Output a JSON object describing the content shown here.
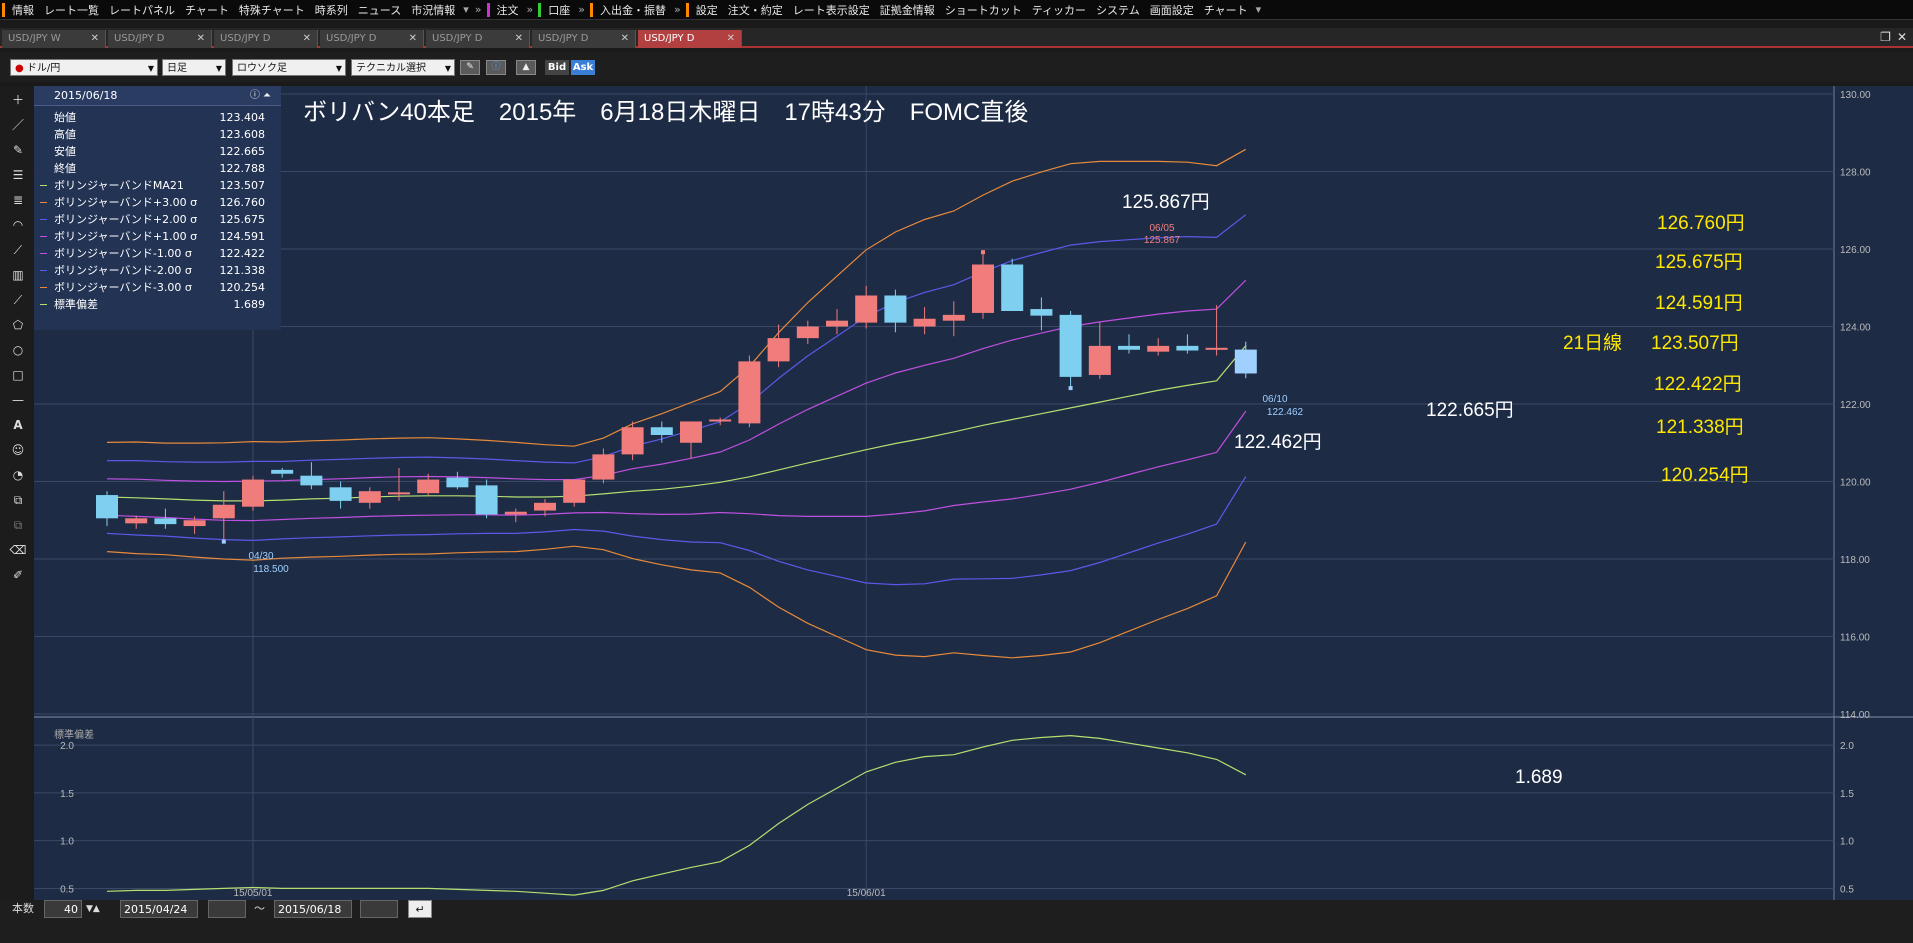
{
  "menu": {
    "items": [
      "情報",
      "レート一覧",
      "レートパネル",
      "チャート",
      "特殊チャート",
      "時系列",
      "ニュース",
      "市況情報",
      "注文",
      "口座",
      "入出金・振替",
      "設定",
      "注文・約定",
      "レート表示設定",
      "証拠金情報",
      "ショートカット",
      "ティッカー",
      "システム",
      "画面設定",
      "チャート"
    ]
  },
  "tabs": [
    {
      "label": "USD/JPY W"
    },
    {
      "label": "USD/JPY D"
    },
    {
      "label": "USD/JPY D"
    },
    {
      "label": "USD/JPY D"
    },
    {
      "label": "USD/JPY D"
    },
    {
      "label": "USD/JPY D"
    },
    {
      "label": "USD/JPY D"
    }
  ],
  "toolbar": {
    "symbol": "ドル/円",
    "period": "日足",
    "charttype": "ロウソク足",
    "technical": "テクニカル選択",
    "bid": "Bid",
    "ask": "Ask"
  },
  "info": {
    "date": "2015/06/18",
    "rows": [
      {
        "label": "始値",
        "value": "123.404",
        "color": ""
      },
      {
        "label": "高値",
        "value": "123.608",
        "color": ""
      },
      {
        "label": "安値",
        "value": "122.665",
        "color": ""
      },
      {
        "label": "終値",
        "value": "122.788",
        "color": ""
      },
      {
        "label": "ボリンジャーバンドMA21",
        "value": "123.507",
        "color": "#b4e070"
      },
      {
        "label": "ボリンジャーバンド+3.00 σ",
        "value": "126.760",
        "color": "#e88a3a"
      },
      {
        "label": "ボリンジャーバンド+2.00 σ",
        "value": "125.675",
        "color": "#5a5ae8"
      },
      {
        "label": "ボリンジャーバンド+1.00 σ",
        "value": "124.591",
        "color": "#c050e0"
      },
      {
        "label": "ボリンジャーバンド-1.00 σ",
        "value": "122.422",
        "color": "#c050e0"
      },
      {
        "label": "ボリンジャーバンド-2.00 σ",
        "value": "121.338",
        "color": "#5a5ae8"
      },
      {
        "label": "ボリンジャーバンド-3.00 σ",
        "value": "120.254",
        "color": "#e88a3a"
      },
      {
        "label": "標準偏差",
        "value": "1.689",
        "color": "#b4e070"
      }
    ]
  },
  "annotations": {
    "title": "ボリバン40本足　2015年　6月18日木曜日　17時43分　FOMC直後",
    "high_label": "125.867円",
    "high_mark_date": "06/05",
    "high_mark_value": "125.867",
    "low_mark_date": "06/10",
    "low_mark_value": "122.462",
    "low_label": "122.462円",
    "close_low_label": "122.665円",
    "early_low_date": "04/30",
    "early_low_value": "118.500",
    "b3u": "126.760円",
    "b2u": "125.675円",
    "b1u": "124.591円",
    "ma_prefix": "21日線",
    "ma": "123.507円",
    "b1l": "122.422円",
    "b2l": "121.338円",
    "b3l": "120.254円",
    "sd_value": "1.689",
    "sd_panel_label": "標準偏差",
    "date_tick_1": "15/05/01",
    "date_tick_2": "15/06/01"
  },
  "bottom": {
    "label": "本数",
    "count": "40",
    "from": "2015/04/24",
    "tilde": "～",
    "to": "2015/06/18"
  },
  "chart_data": {
    "type": "candlestick",
    "colors": {
      "up": "#f07c7c",
      "down": "#7fd0f0",
      "last": "#a0d0ff",
      "ma": "#b4e070",
      "sigma3": "#e88a3a",
      "sigma2": "#5a5ae8",
      "sigma1": "#c050e0",
      "sd": "#b4e070",
      "text_yellow": "#ffe800"
    },
    "ylim": [
      114,
      130
    ],
    "yticks": [
      "114.00",
      "116.00",
      "118.00",
      "120.00",
      "122.00",
      "124.00",
      "126.00",
      "128.00",
      "130.00"
    ],
    "sd_ylim": [
      0.4,
      2.2
    ],
    "sd_yticks": [
      "0.5",
      "1.0",
      "1.5",
      "2.0"
    ],
    "candles": [
      {
        "o": 119.65,
        "h": 119.75,
        "l": 118.85,
        "c": 119.05
      },
      {
        "o": 118.92,
        "h": 119.12,
        "l": 118.78,
        "c": 119.05
      },
      {
        "o": 119.05,
        "h": 119.3,
        "l": 118.78,
        "c": 118.9
      },
      {
        "o": 118.85,
        "h": 119.1,
        "l": 118.65,
        "c": 119.0
      },
      {
        "o": 119.05,
        "h": 119.75,
        "l": 118.5,
        "c": 119.4
      },
      {
        "o": 119.35,
        "h": 120.15,
        "l": 119.25,
        "c": 120.05
      },
      {
        "o": 120.3,
        "h": 120.35,
        "l": 120.1,
        "c": 120.2
      },
      {
        "o": 120.15,
        "h": 120.5,
        "l": 119.8,
        "c": 119.9
      },
      {
        "o": 119.85,
        "h": 120.0,
        "l": 119.3,
        "c": 119.5
      },
      {
        "o": 119.45,
        "h": 119.85,
        "l": 119.3,
        "c": 119.75
      },
      {
        "o": 119.7,
        "h": 120.35,
        "l": 119.5,
        "c": 119.72
      },
      {
        "o": 119.7,
        "h": 120.2,
        "l": 119.65,
        "c": 120.05
      },
      {
        "o": 120.1,
        "h": 120.25,
        "l": 119.8,
        "c": 119.85
      },
      {
        "o": 119.9,
        "h": 120.05,
        "l": 119.05,
        "c": 119.15
      },
      {
        "o": 119.15,
        "h": 119.3,
        "l": 118.95,
        "c": 119.22
      },
      {
        "o": 119.25,
        "h": 119.55,
        "l": 119.1,
        "c": 119.45
      },
      {
        "o": 119.45,
        "h": 120.05,
        "l": 119.35,
        "c": 120.05
      },
      {
        "o": 120.05,
        "h": 120.85,
        "l": 119.95,
        "c": 120.7
      },
      {
        "o": 120.7,
        "h": 121.55,
        "l": 120.55,
        "c": 121.4
      },
      {
        "o": 121.4,
        "h": 121.55,
        "l": 121.0,
        "c": 121.2
      },
      {
        "o": 121.0,
        "h": 121.55,
        "l": 120.6,
        "c": 121.55
      },
      {
        "o": 121.55,
        "h": 121.65,
        "l": 121.45,
        "c": 121.6
      },
      {
        "o": 121.5,
        "h": 123.25,
        "l": 121.4,
        "c": 123.1
      },
      {
        "o": 123.1,
        "h": 124.05,
        "l": 122.95,
        "c": 123.7
      },
      {
        "o": 123.7,
        "h": 124.15,
        "l": 123.55,
        "c": 124.0
      },
      {
        "o": 124.0,
        "h": 124.45,
        "l": 123.8,
        "c": 124.15
      },
      {
        "o": 124.1,
        "h": 125.05,
        "l": 123.95,
        "c": 124.8
      },
      {
        "o": 124.8,
        "h": 124.95,
        "l": 123.85,
        "c": 124.1
      },
      {
        "o": 124.0,
        "h": 124.5,
        "l": 123.8,
        "c": 124.2
      },
      {
        "o": 124.15,
        "h": 124.65,
        "l": 123.75,
        "c": 124.3
      },
      {
        "o": 124.35,
        "h": 125.867,
        "l": 124.2,
        "c": 125.6
      },
      {
        "o": 125.6,
        "h": 125.75,
        "l": 124.4,
        "c": 124.4
      },
      {
        "o": 124.45,
        "h": 124.75,
        "l": 123.9,
        "c": 124.28
      },
      {
        "o": 124.3,
        "h": 124.4,
        "l": 122.462,
        "c": 122.7
      },
      {
        "o": 122.75,
        "h": 124.1,
        "l": 122.65,
        "c": 123.5
      },
      {
        "o": 123.5,
        "h": 123.8,
        "l": 123.3,
        "c": 123.4
      },
      {
        "o": 123.35,
        "h": 123.7,
        "l": 123.25,
        "c": 123.5
      },
      {
        "o": 123.5,
        "h": 123.8,
        "l": 123.3,
        "c": 123.38
      },
      {
        "o": 123.404,
        "h": 124.55,
        "l": 123.25,
        "c": 123.45
      },
      {
        "o": 123.404,
        "h": 123.608,
        "l": 122.665,
        "c": 122.788
      }
    ],
    "ma": [
      119.6,
      119.58,
      119.55,
      119.52,
      119.5,
      119.5,
      119.52,
      119.55,
      119.57,
      119.6,
      119.62,
      119.63,
      119.63,
      119.62,
      119.6,
      119.6,
      119.62,
      119.68,
      119.75,
      119.8,
      119.88,
      119.98,
      120.12,
      120.3,
      120.48,
      120.65,
      120.82,
      120.98,
      121.12,
      121.28,
      121.45,
      121.6,
      121.75,
      121.9,
      122.05,
      122.2,
      122.35,
      122.48,
      122.6,
      123.507
    ],
    "sd": [
      0.47,
      0.48,
      0.48,
      0.49,
      0.5,
      0.51,
      0.5,
      0.5,
      0.5,
      0.5,
      0.5,
      0.5,
      0.49,
      0.48,
      0.47,
      0.45,
      0.43,
      0.48,
      0.58,
      0.65,
      0.72,
      0.78,
      0.95,
      1.18,
      1.38,
      1.55,
      1.72,
      1.82,
      1.88,
      1.9,
      1.98,
      2.05,
      2.08,
      2.1,
      2.07,
      2.02,
      1.97,
      1.92,
      1.85,
      1.689
    ]
  }
}
